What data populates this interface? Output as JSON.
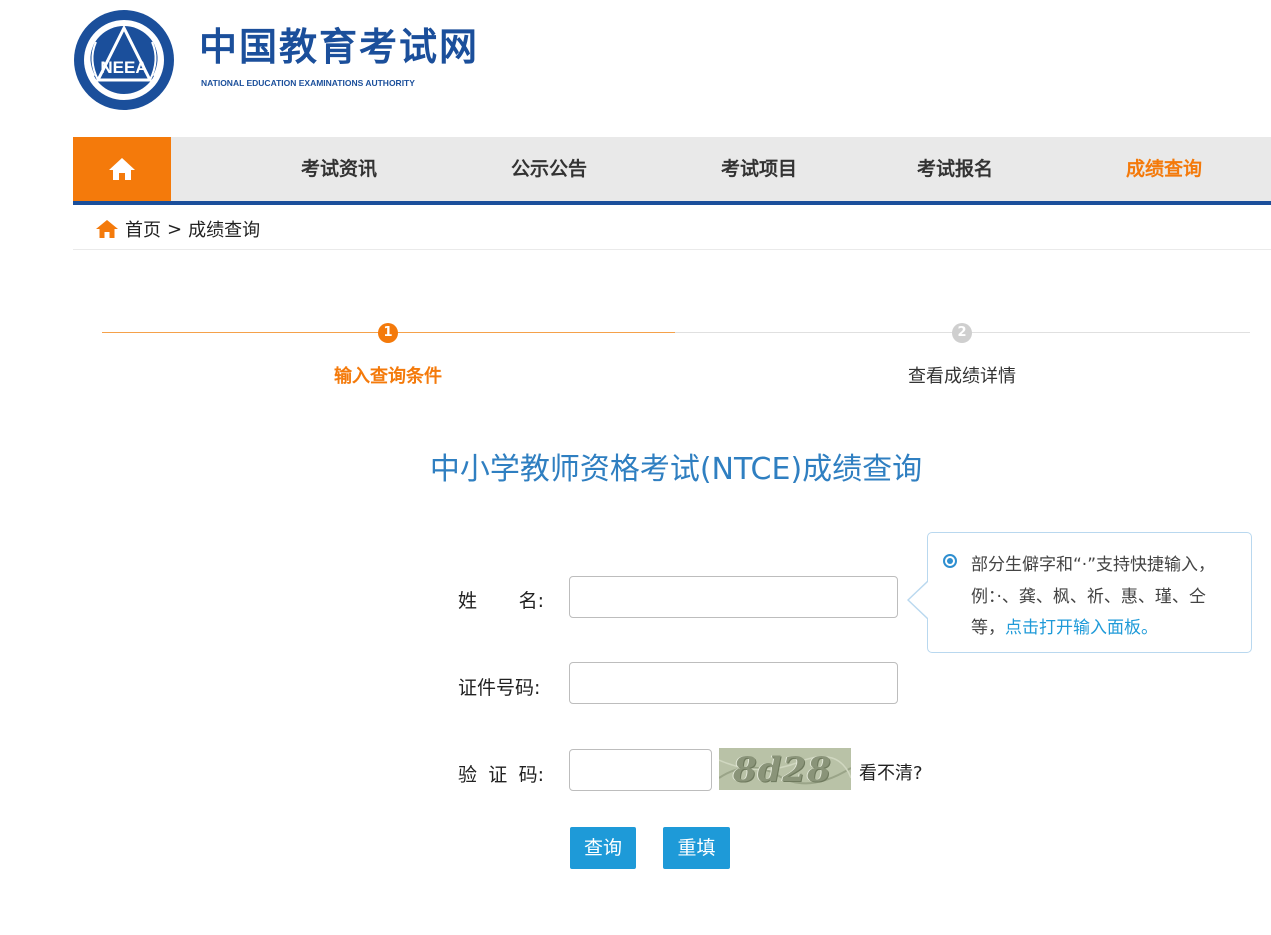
{
  "header": {
    "logo_text": "NEEA",
    "site_title": "中国教育考试网",
    "site_subtitle": "NATIONAL EDUCATION EXAMINATIONS AUTHORITY"
  },
  "nav": {
    "home_icon": "home-icon",
    "items": [
      {
        "label": "考试资讯",
        "active": false
      },
      {
        "label": "公示公告",
        "active": false
      },
      {
        "label": "考试项目",
        "active": false
      },
      {
        "label": "考试报名",
        "active": false
      },
      {
        "label": "成绩查询",
        "active": true
      }
    ]
  },
  "breadcrumb": {
    "home": "首页",
    "separator": ">",
    "current": "成绩查询"
  },
  "steps": [
    {
      "number": "1",
      "label": "输入查询条件",
      "active": true
    },
    {
      "number": "2",
      "label": "查看成绩详情",
      "active": false
    }
  ],
  "page_title": "中小学教师资格考试(NTCE)成绩查询",
  "form": {
    "name_label_chars": [
      "姓",
      "名:"
    ],
    "name_value": "",
    "id_label": "证件号码:",
    "id_value": "",
    "code_label_chars": [
      "验",
      "证",
      "码:"
    ],
    "code_value": "",
    "captcha_text": "8d28",
    "refresh_text": "看不清?",
    "query_button": "查询",
    "reset_button": "重填"
  },
  "tooltip": {
    "text": "部分生僻字和“·”支持快捷输入，例：·、龚、枫、祈、惠、瑾、仝等，",
    "link": "点击打开输入面板。"
  },
  "colors": {
    "brand_blue": "#1b4f9b",
    "accent_orange": "#f47a0b",
    "button_blue": "#1e9ad8",
    "title_blue": "#2f7fc1"
  }
}
